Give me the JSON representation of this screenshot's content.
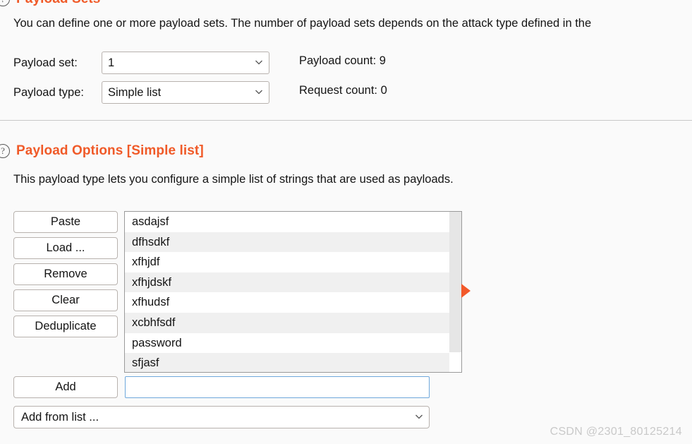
{
  "payload_sets": {
    "title": "Payload Sets",
    "help_icon": "question-circle-icon",
    "description": "You can define one or more payload sets. The number of payload sets depends on the attack type defined in the",
    "payload_set": {
      "label": "Payload set:",
      "value": "1",
      "chevron": "chevron-down-icon"
    },
    "payload_type": {
      "label": "Payload type:",
      "value": "Simple list",
      "chevron": "chevron-down-icon"
    },
    "payload_count": "Payload count: 9",
    "request_count": "Request count: 0"
  },
  "payload_options": {
    "title": "Payload Options [Simple list]",
    "help_icon": "question-circle-icon",
    "description": "This payload type lets you configure a simple list of strings that are used as payloads.",
    "buttons": [
      {
        "label": "Paste"
      },
      {
        "label": "Load ..."
      },
      {
        "label": "Remove"
      },
      {
        "label": "Clear"
      },
      {
        "label": "Deduplicate"
      }
    ],
    "payload_list": [
      "asdajsf",
      "dfhsdkf",
      "xfhjdf",
      "xfhjdskf",
      "xfhudsf",
      "xcbhfsdf",
      "password",
      "sfjasf"
    ],
    "scrollbar": {
      "name": "vertical-scrollbar"
    },
    "marker_icon": "triangle-right-icon",
    "add": {
      "button_label": "Add",
      "input_value": "",
      "input_placeholder": ""
    },
    "add_from_list": {
      "label": "Add from list ...",
      "chevron": "chevron-down-icon"
    }
  },
  "watermark": "CSDN @2301_80125214",
  "colors": {
    "accent": "#f05a28",
    "marker": "#f2592a",
    "focus_border": "#6fa8dc",
    "background": "#fafafa",
    "row_alt": "#f0f0f0"
  }
}
